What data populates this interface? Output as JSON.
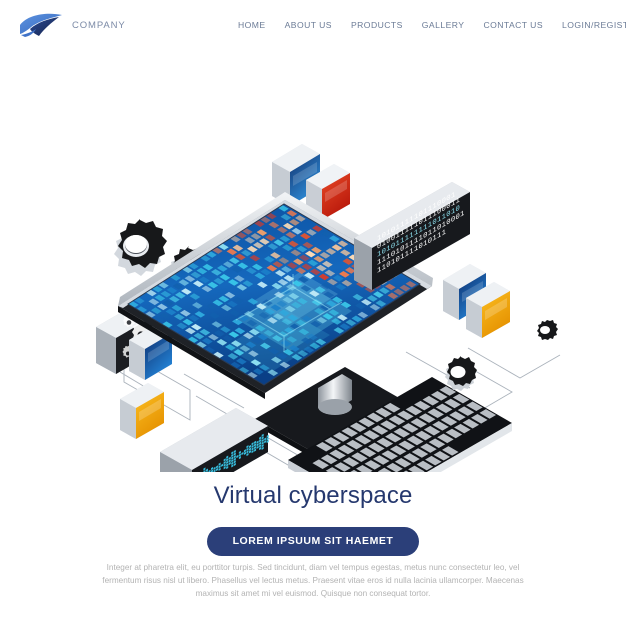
{
  "header": {
    "brand_name": "COMPANY",
    "logo_icon": "wing-swoosh-logo",
    "logo_colors": {
      "light": "#4a7fd6",
      "mid": "#3f6fc4",
      "dark": "#1d2a53"
    },
    "nav": [
      {
        "label": "HOME"
      },
      {
        "label": "ABOUT US"
      },
      {
        "label": "PRODUCTS"
      },
      {
        "label": "GALLERY"
      },
      {
        "label": "CONTACT US"
      },
      {
        "label": "LOGIN/REGISTER"
      }
    ]
  },
  "hero": {
    "alt": "isometric desktop computer with pixelated cyberspace screen, keyboard, gears, binary code panel and floating app tiles",
    "elements": [
      {
        "name": "monitor",
        "note": "isometric display with mosaic pixel grid"
      },
      {
        "name": "keyboard",
        "note": "isometric black keyboard with grey keys"
      },
      {
        "name": "binary-panel",
        "note": "dark rounded panel showing binary digits"
      },
      {
        "name": "equalizer-panel",
        "note": "dark rounded panel with cyan waveform dots"
      },
      {
        "name": "settings-panel",
        "note": "dark rounded panel with white gear cluster"
      },
      {
        "name": "gear-large"
      },
      {
        "name": "gear-small"
      },
      {
        "name": "gear-right"
      },
      {
        "name": "gear-bottom"
      },
      {
        "name": "tile-blue-top"
      },
      {
        "name": "tile-red-top"
      },
      {
        "name": "tile-blue-left"
      },
      {
        "name": "tile-orange-left"
      },
      {
        "name": "tile-blue-right"
      },
      {
        "name": "tile-orange-right"
      }
    ],
    "binary_rows": [
      "110101111010111",
      "1110101111011010001",
      "101011111111011010",
      "010011111011100011",
      "10101111101110001"
    ],
    "palette": {
      "screen_deep_blue": "#0f4f9e",
      "screen_mid_blue": "#1f74c8",
      "screen_cyan": "#39c6e8",
      "screen_pale": "#bfe9f6",
      "screen_orange": "#f0a06a",
      "screen_red": "#e03a22",
      "bezel_silver": "#c9ced4",
      "bezel_dark": "#1e2127",
      "tile_blue": "#1f7fd4",
      "tile_blue_dark": "#123a74",
      "tile_red": "#cf2010",
      "tile_orange": "#f5a800",
      "gear_black": "#1b1b1b",
      "line_grey": "#9aa3ad"
    }
  },
  "footer": {
    "headline": "Virtual cyberspace",
    "cta_label": "LOREM IPSUUM SIT HAEMET",
    "cta_color": "#2b3f79",
    "paragraph": "Integer at pharetra elit, eu porttitor turpis. Sed tincidunt, diam vel tempus egestas, metus nunc consectetur leo, vel fermentum risus nisl ut libero. Phasellus vel lectus metus. Praesent vitae eros id nulla lacinia ullamcorper. Maecenas maximus sit amet mi vel euismod. Quisque non consequat tortor."
  }
}
